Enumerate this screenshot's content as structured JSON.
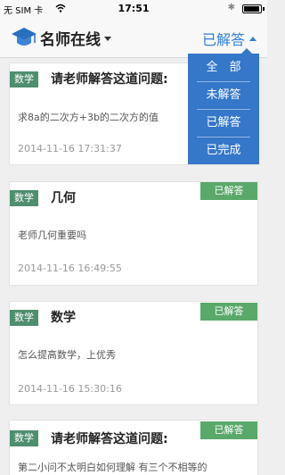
{
  "status_bar": {
    "carrier": "无 SIM 卡",
    "time": "17:51"
  },
  "nav": {
    "title": "名师在线",
    "filter_label": "已解答"
  },
  "dropdown": {
    "items": [
      {
        "label": "全　部"
      },
      {
        "label": "未解答"
      },
      {
        "label": "已解答"
      },
      {
        "label": "已完成"
      }
    ]
  },
  "questions": [
    {
      "subject": "数学",
      "title": "请老师解答这道问题:",
      "body": "求8a的二次方+3b的二次方的值",
      "time": "2014-11-16 17:31:37",
      "status": ""
    },
    {
      "subject": "数学",
      "title": "几何",
      "body": "老师几何重要吗",
      "time": "2014-11-16 16:49:55",
      "status": "已解答"
    },
    {
      "subject": "数学",
      "title": "数学",
      "body": "怎么提高数学，上优秀",
      "time": "2014-11-16 15:30:16",
      "status": "已解答"
    },
    {
      "subject": "数学",
      "title": "请老师解答这道问题:",
      "body": "第二小问不太明白如何理解 有三个不相等的",
      "time": "",
      "status": "已解答"
    }
  ],
  "colors": {
    "accent": "#2d7fd6",
    "dropdown_bg": "#3577c8",
    "subject_tag": "#4f8e6e",
    "status_badge": "#5aa96a"
  }
}
